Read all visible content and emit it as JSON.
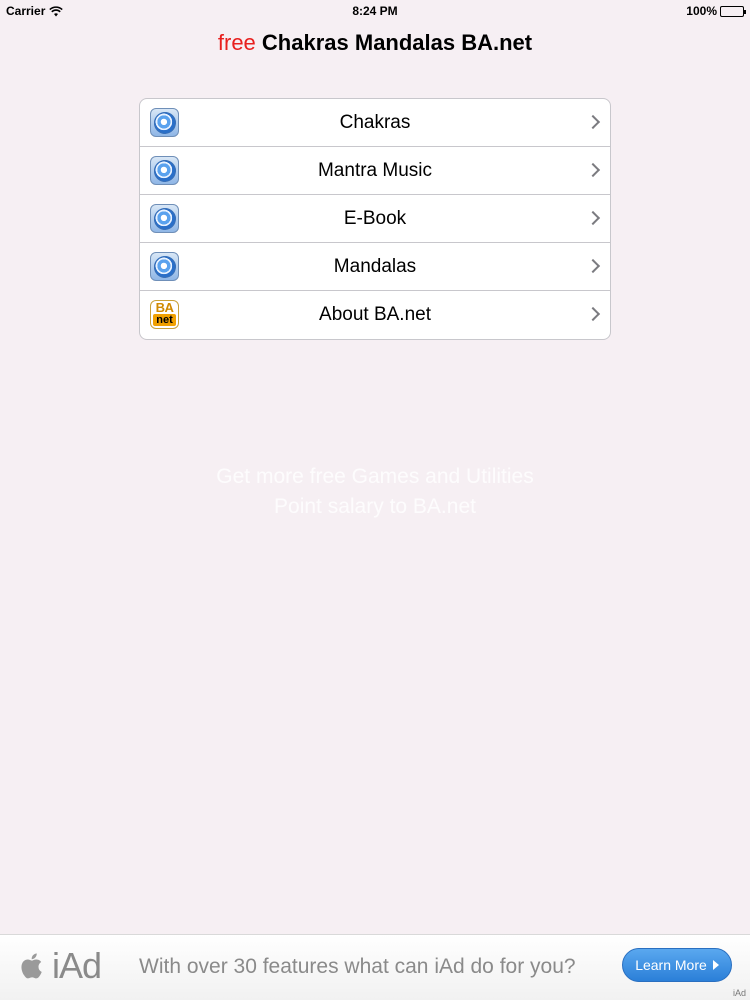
{
  "status_bar": {
    "carrier": "Carrier",
    "time": "8:24 PM",
    "battery": "100%"
  },
  "title": {
    "prefix": "free",
    "main": "Chakras Mandalas BA.net"
  },
  "menu": {
    "items": [
      {
        "label": "Chakras",
        "icon": "chakra-icon"
      },
      {
        "label": "Mantra Music",
        "icon": "chakra-icon"
      },
      {
        "label": "E-Book",
        "icon": "chakra-icon"
      },
      {
        "label": "Mandalas",
        "icon": "chakra-icon"
      },
      {
        "label": "About BA.net",
        "icon": "banet-logo-icon",
        "icon_text_top": "BA",
        "icon_text_bottom": "net"
      }
    ]
  },
  "promo": {
    "line1": "Get more free Games and Utilities",
    "line2": "Point salary to BA.net"
  },
  "iad": {
    "logo": "iAd",
    "message": "With over 30 features what can iAd do for you?",
    "button_label": "Learn More",
    "corner_label": "iAd"
  },
  "colors": {
    "background": "#f6eff3",
    "title_free": "#e8201e",
    "button_blue": "#2b7fd8"
  }
}
